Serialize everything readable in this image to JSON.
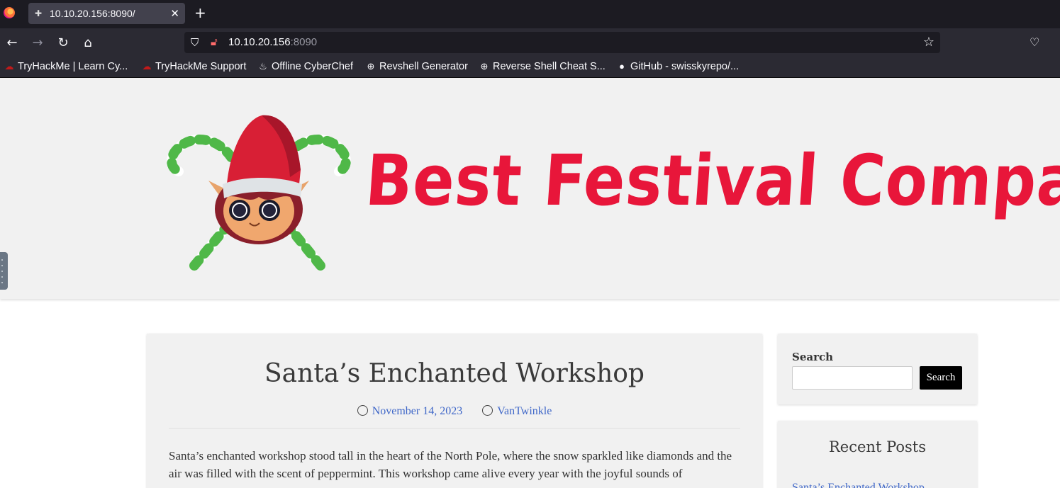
{
  "browser": {
    "tab_title": "10.10.20.156:8090/",
    "tab_close": "✕",
    "new_tab": "+",
    "url_host": "10.10.20.156",
    "url_port": ":8090",
    "bookmarks": [
      "TryHackMe | Learn Cy...",
      "TryHackMe Support",
      "Offline CyberChef",
      "Revshell Generator",
      "Reverse Shell Cheat S...",
      "GitHub - swisskyrepo/..."
    ]
  },
  "site": {
    "brand": "Best Festival Company",
    "colors": {
      "brand": "#e8163a",
      "link": "#3f67c8",
      "header_bg": "#f1f1f1"
    }
  },
  "post": {
    "title": "Santa’s Enchanted Workshop",
    "date": "November 14, 2023",
    "author": "VanTwinkle",
    "excerpt": "Santa’s enchanted workshop stood tall in the heart of the North Pole, where the snow sparkled like diamonds and the air was filled with the scent of peppermint. This workshop came alive every year with the joyful sounds of"
  },
  "sidebar": {
    "search_label": "Search",
    "search_button": "Search",
    "recent_title": "Recent Posts",
    "recent_posts": [
      "Santa’s Enchanted Workshop"
    ]
  }
}
